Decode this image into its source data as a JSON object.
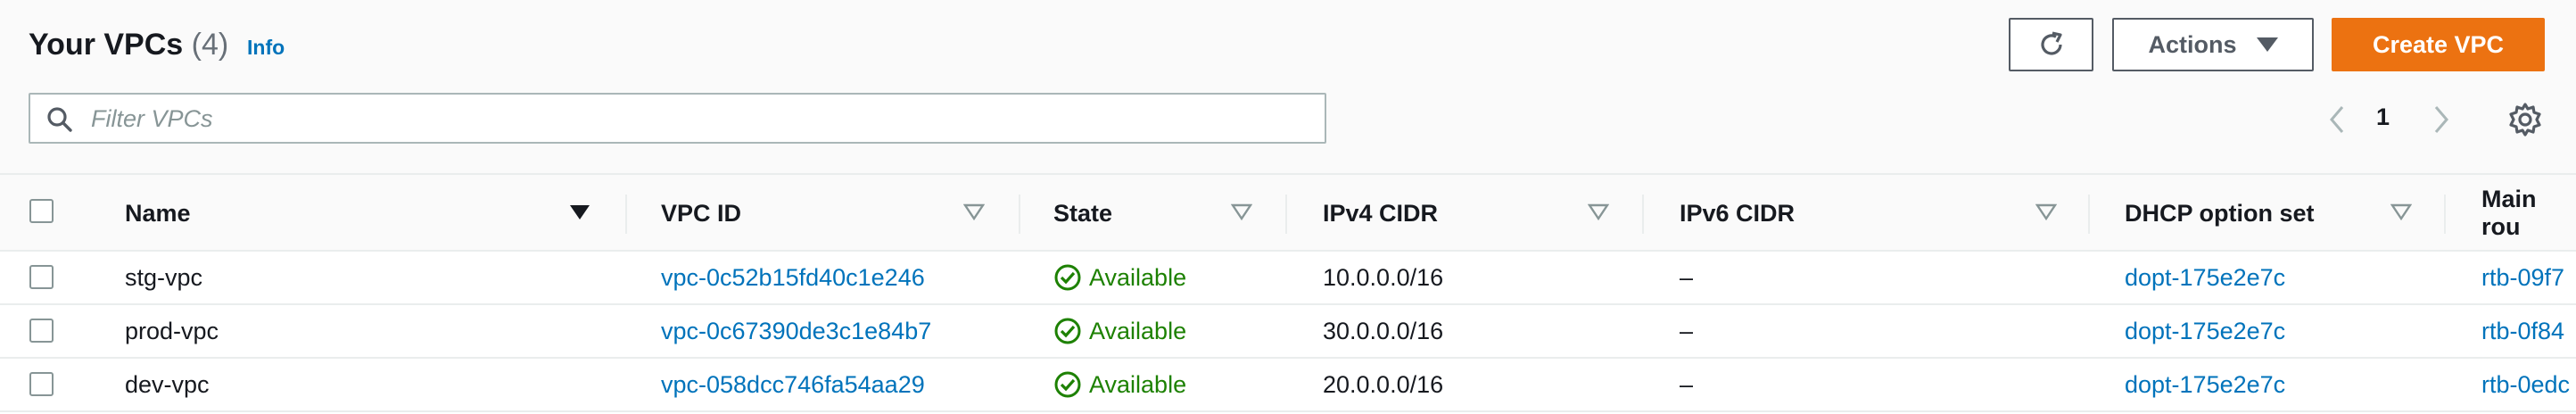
{
  "header": {
    "title": "Your VPCs",
    "count": "(4)",
    "info": "Info",
    "actions_label": "Actions",
    "create_label": "Create VPC"
  },
  "filter": {
    "placeholder": "Filter VPCs",
    "value": ""
  },
  "pagination": {
    "current_page": "1"
  },
  "columns": [
    "Name",
    "VPC ID",
    "State",
    "IPv4 CIDR",
    "IPv6 CIDR",
    "DHCP option set",
    "Main rou"
  ],
  "rows": [
    {
      "name": "stg-vpc",
      "vpc_id": "vpc-0c52b15fd40c1e246",
      "state": "Available",
      "ipv4": "10.0.0.0/16",
      "ipv6": "–",
      "dhcp": "dopt-175e2e7c",
      "main_rt": "rtb-09f7"
    },
    {
      "name": "prod-vpc",
      "vpc_id": "vpc-0c67390de3c1e84b7",
      "state": "Available",
      "ipv4": "30.0.0.0/16",
      "ipv6": "–",
      "dhcp": "dopt-175e2e7c",
      "main_rt": "rtb-0f84"
    },
    {
      "name": "dev-vpc",
      "vpc_id": "vpc-058dcc746fa54aa29",
      "state": "Available",
      "ipv4": "20.0.0.0/16",
      "ipv6": "–",
      "dhcp": "dopt-175e2e7c",
      "main_rt": "rtb-0edc"
    }
  ],
  "colors": {
    "accent": "#ec7211",
    "link": "#0073bb",
    "success": "#1d8102"
  },
  "icons": [
    "refresh-icon",
    "caret-down-icon",
    "search-icon",
    "chevron-left-icon",
    "chevron-right-icon",
    "gear-icon",
    "sort-desc-icon",
    "sort-icon",
    "status-available-icon"
  ]
}
